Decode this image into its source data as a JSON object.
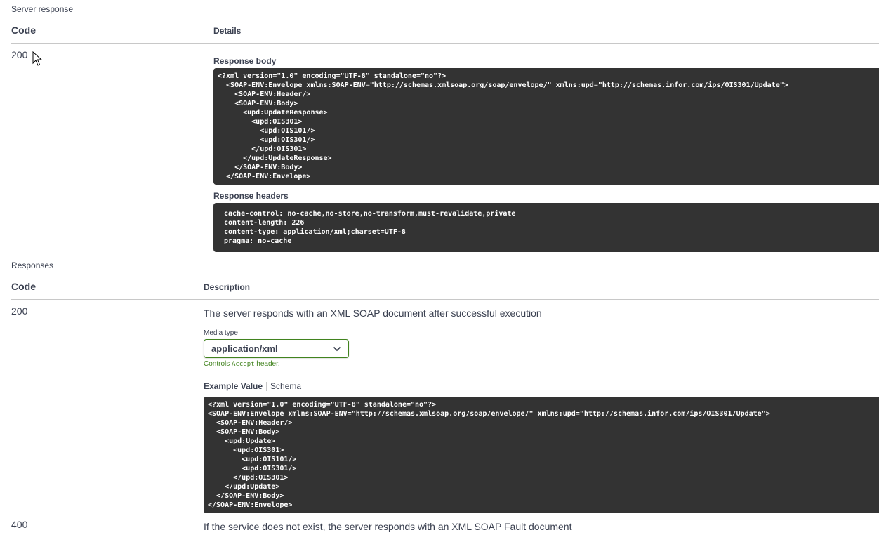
{
  "server_response": {
    "title": "Server response",
    "col_code": "Code",
    "col_details": "Details",
    "code": "200",
    "response_body_label": "Response body",
    "response_body": "<?xml version=\"1.0\" encoding=\"UTF-8\" standalone=\"no\"?>\n  <SOAP-ENV:Envelope xmlns:SOAP-ENV=\"http://schemas.xmlsoap.org/soap/envelope/\" xmlns:upd=\"http://schemas.infor.com/ips/OIS301/Update\">\n    <SOAP-ENV:Header/>\n    <SOAP-ENV:Body>\n      <upd:UpdateResponse>\n        <upd:OIS301>\n          <upd:OIS101/>\n          <upd:OIS301/>\n        </upd:OIS301>\n      </upd:UpdateResponse>\n    </SOAP-ENV:Body>\n  </SOAP-ENV:Envelope>",
    "response_headers_label": "Response headers",
    "response_headers": " cache-control: no-cache,no-store,no-transform,must-revalidate,private\n content-length: 226\n content-type: application/xml;charset=UTF-8\n pragma: no-cache"
  },
  "responses": {
    "title": "Responses",
    "col_code": "Code",
    "col_description": "Description",
    "items": [
      {
        "code": "200",
        "description": "The server responds with an XML SOAP document after successful execution",
        "media_type_label": "Media type",
        "media_type_value": "application/xml",
        "controls_prefix": "Controls ",
        "controls_code": "Accept",
        "controls_suffix": " header.",
        "tab_example": "Example Value",
        "tab_schema": "Schema",
        "example": "<?xml version=\"1.0\" encoding=\"UTF-8\" standalone=\"no\"?>\n<SOAP-ENV:Envelope xmlns:SOAP-ENV=\"http://schemas.xmlsoap.org/soap/envelope/\" xmlns:upd=\"http://schemas.infor.com/ips/OIS301/Update\">\n  <SOAP-ENV:Header/>\n  <SOAP-ENV:Body>\n    <upd:Update>\n      <upd:OIS301>\n        <upd:OIS101/>\n        <upd:OIS301/>\n      </upd:OIS301>\n    </upd:Update>\n  </SOAP-ENV:Body>\n</SOAP-ENV:Envelope>"
      },
      {
        "code": "400",
        "description": "If the service does not exist, the server responds with an XML SOAP Fault document"
      }
    ]
  },
  "colors": {
    "code_bg": "#333333",
    "text": "#3b4151",
    "accent_green": "#41831e"
  },
  "icons": {
    "select_chevron": "chevron-down-icon",
    "cursor": "mouse-pointer-icon"
  }
}
